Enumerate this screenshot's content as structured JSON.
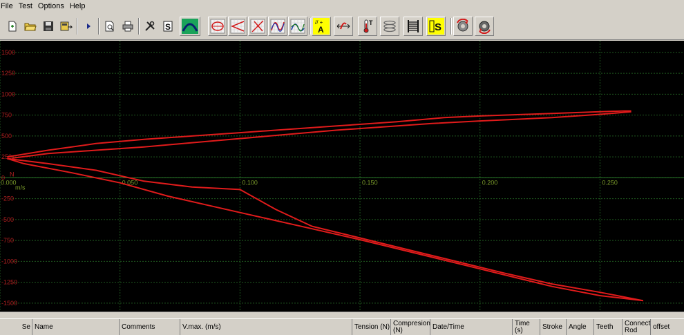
{
  "menu": [
    "File",
    "Test",
    "Options",
    "Help"
  ],
  "toolbar_icons": [
    "new-test-icon",
    "open-folder-icon",
    "save-icon",
    "export-icon",
    "run-icon",
    "print-preview-icon",
    "print-icon",
    "tools-icon",
    "s-mode-icon",
    "curve-icon",
    "force-displacement-icon",
    "force-velocity-icon",
    "force-acceleration-icon",
    "force-time-icon",
    "compare-curves-icon",
    "tension-compression-icon",
    "stretch-icon",
    "temperature-icon",
    "spring-icon",
    "coil-icon",
    "s-yellow-icon",
    "rotate-red-icon",
    "rotate-gear-icon"
  ],
  "colors": {
    "grid": "#1f5a1f",
    "curve": "#e01b1b",
    "background": "#000000",
    "x_label": "#7a9a2a",
    "y_label": "#b02020"
  },
  "chart_data": {
    "type": "line",
    "x_unit": "m/s",
    "y_unit": "N",
    "x_ticks": [
      "0.000",
      "0.050",
      "0.100",
      "0.150",
      "0.200",
      "0.250"
    ],
    "y_ticks": [
      "1500",
      "1250",
      "1000",
      "750",
      "500",
      "250",
      "0",
      "-250",
      "-500",
      "-750",
      "-1000",
      "-1250",
      "-1500"
    ],
    "xlim": [
      0.0,
      0.285
    ],
    "ylim": [
      -1600,
      1640
    ],
    "grid": true,
    "series": [
      {
        "x": [
          0.003,
          0.02,
          0.04,
          0.06,
          0.08,
          0.1,
          0.12,
          0.14,
          0.165,
          0.185,
          0.2,
          0.22,
          0.24,
          0.26,
          0.263
        ],
        "y": [
          250,
          330,
          410,
          460,
          500,
          540,
          580,
          620,
          670,
          720,
          740,
          760,
          780,
          800,
          800
        ]
      },
      {
        "x": [
          0.263,
          0.25,
          0.23,
          0.2,
          0.18,
          0.16,
          0.14,
          0.12,
          0.1,
          0.08,
          0.06,
          0.04,
          0.02,
          0.005
        ],
        "y": [
          790,
          760,
          720,
          680,
          650,
          610,
          570,
          520,
          470,
          420,
          370,
          330,
          290,
          235
        ]
      },
      {
        "x": [
          0.003,
          0.02,
          0.04,
          0.06,
          0.08,
          0.1,
          0.115,
          0.13,
          0.15,
          0.17,
          0.19,
          0.21,
          0.23,
          0.25,
          0.268
        ],
        "y": [
          230,
          170,
          90,
          -40,
          -110,
          -140,
          -380,
          -580,
          -720,
          -860,
          -1000,
          -1140,
          -1270,
          -1370,
          -1470
        ]
      },
      {
        "x": [
          0.268,
          0.25,
          0.23,
          0.21,
          0.19,
          0.17,
          0.15,
          0.13,
          0.11,
          0.09,
          0.07,
          0.05,
          0.03,
          0.01,
          0.003
        ],
        "y": [
          -1470,
          -1410,
          -1300,
          -1160,
          -1020,
          -880,
          -740,
          -610,
          -480,
          -350,
          -220,
          -60,
          60,
          170,
          230
        ]
      }
    ]
  },
  "table_header": [
    "Se",
    "Name",
    "Comments",
    "V.max. (m/s)",
    "Tension (N)",
    "Compresion (N)",
    "Date/Time",
    "Time (s)",
    "Stroke",
    "Angle",
    "Teeth",
    "Connect Rod",
    "offset"
  ]
}
